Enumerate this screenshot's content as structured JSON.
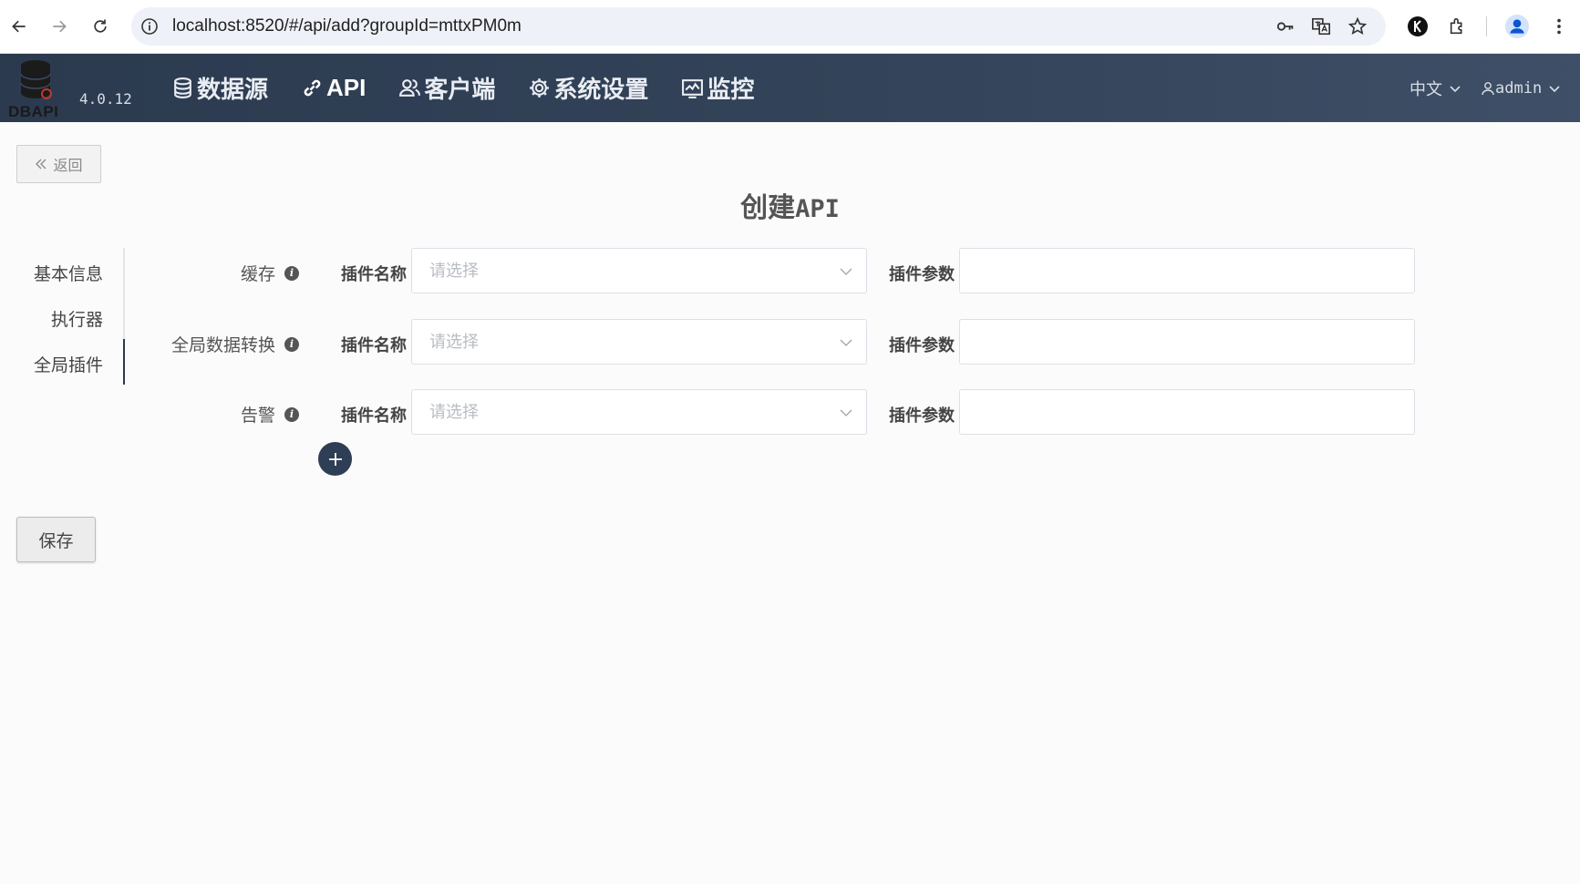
{
  "browser": {
    "url": "localhost:8520/#/api/add?groupId=mttxPM0m"
  },
  "header": {
    "logo_text": "DBAPI",
    "version": "4.0.12",
    "nav": [
      {
        "label": "数据源",
        "icon": "database-icon"
      },
      {
        "label": "API",
        "icon": "api-link-icon"
      },
      {
        "label": "客户端",
        "icon": "users-icon"
      },
      {
        "label": "系统设置",
        "icon": "gear-icon"
      },
      {
        "label": "监控",
        "icon": "monitor-chart-icon"
      }
    ],
    "language": "中文",
    "user": "admin"
  },
  "back_label": "返回",
  "title": {
    "cn": "创建",
    "en": "API"
  },
  "side_tabs": [
    {
      "label": "基本信息",
      "active": false
    },
    {
      "label": "执行器",
      "active": false
    },
    {
      "label": "全局插件",
      "active": true
    }
  ],
  "plugin_rows": [
    {
      "label": "缓存",
      "name_label": "插件名称",
      "placeholder": "请选择",
      "param_label": "插件参数",
      "param_value": ""
    },
    {
      "label": "全局数据转换",
      "name_label": "插件名称",
      "placeholder": "请选择",
      "param_label": "插件参数",
      "param_value": ""
    },
    {
      "label": "告警",
      "name_label": "插件名称",
      "placeholder": "请选择",
      "param_label": "插件参数",
      "param_value": ""
    }
  ],
  "save_label": "保存",
  "colors": {
    "header": "#2b3a4f",
    "accent": "#2e3e54"
  }
}
